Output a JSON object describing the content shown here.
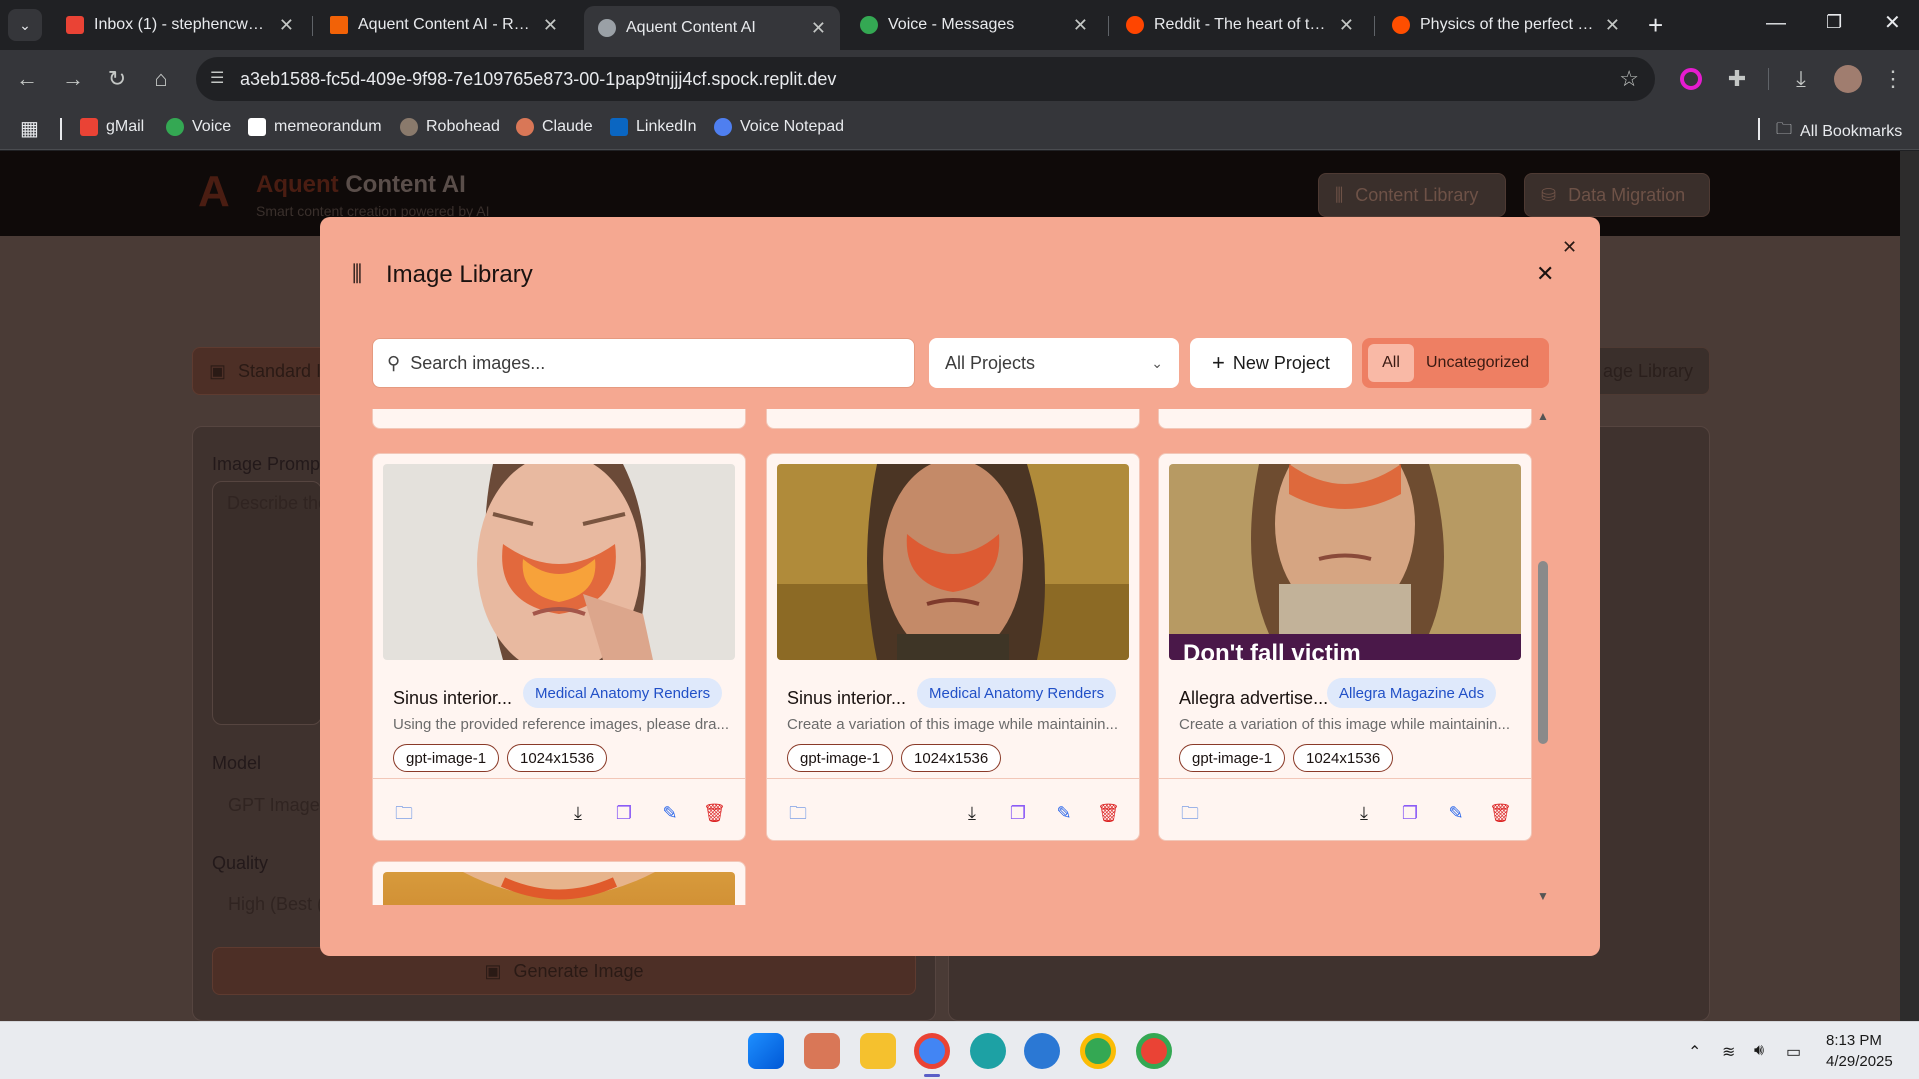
{
  "browser": {
    "tabs": [
      {
        "title": "Inbox (1) - stephencwebste",
        "icon": "gmail-icon",
        "color": "#ea4335"
      },
      {
        "title": "Aquent Content AI - Replit",
        "icon": "replit-icon",
        "color": "#f26207"
      },
      {
        "title": "Aquent Content AI",
        "icon": "globe-icon",
        "color": "#9aa0a6"
      },
      {
        "title": "Voice - Messages",
        "icon": "voice-icon",
        "color": "#34a853"
      },
      {
        "title": "Reddit - The heart of the in",
        "icon": "reddit-icon",
        "color": "#ff4500"
      },
      {
        "title": "Physics of the perfect cacio",
        "icon": "ars-icon",
        "color": "#ff4e00"
      }
    ],
    "url": "a3eb1588-fc5d-409e-9f98-7e109765e873-00-1pap9tnjjj4cf.spock.replit.dev",
    "bookmarks": [
      "gMail",
      "Voice",
      "memeorandum",
      "Robohead",
      "Claude",
      "LinkedIn",
      "Voice Notepad"
    ],
    "all_bookmarks": "All Bookmarks"
  },
  "app": {
    "logo_letter": "A",
    "brand_accent": "Aquent",
    "brand_rest": " Content AI",
    "tagline": "Smart content creation powered by AI",
    "nav": [
      "Content Library",
      "Data Migration"
    ],
    "mode_tab": "Standard I",
    "image_library_tab": "age Library",
    "prompt_label": "Image Promp",
    "prompt_placeholder": "Describe the",
    "model_label": "Model",
    "model_value": "GPT Image (",
    "quality_label": "Quality",
    "quality_value": "High (Best (",
    "generate_label": "Generate Image"
  },
  "modal": {
    "title": "Image Library",
    "search_placeholder": "Search images...",
    "project_filter": "All Projects",
    "new_project": "New Project",
    "filters": [
      "All",
      "Uncategorized"
    ],
    "cards": [
      {
        "title": "Sinus interior...",
        "project": "Medical Anatomy Renders",
        "desc": "Using the provided reference images, please dra...",
        "model": "gpt-image-1",
        "size": "1024x1536"
      },
      {
        "title": "Sinus interior...",
        "project": "Medical Anatomy Renders",
        "desc": "Create a variation of this image while maintainin...",
        "model": "gpt-image-1",
        "size": "1024x1536"
      },
      {
        "title": "Allegra advertise...",
        "project": "Allegra Magazine Ads",
        "desc": "Create a variation of this image while maintainin...",
        "model": "gpt-image-1",
        "size": "1024x1536",
        "overlay_text": "Don't fall victim"
      }
    ]
  },
  "taskbar": {
    "time": "8:13 PM",
    "date": "4/29/2025"
  },
  "colors": {
    "modal_bg": "#f5a891",
    "badge_bg": "#dfe9fb",
    "badge_text": "#2150c7",
    "delete": "#dc2626"
  }
}
